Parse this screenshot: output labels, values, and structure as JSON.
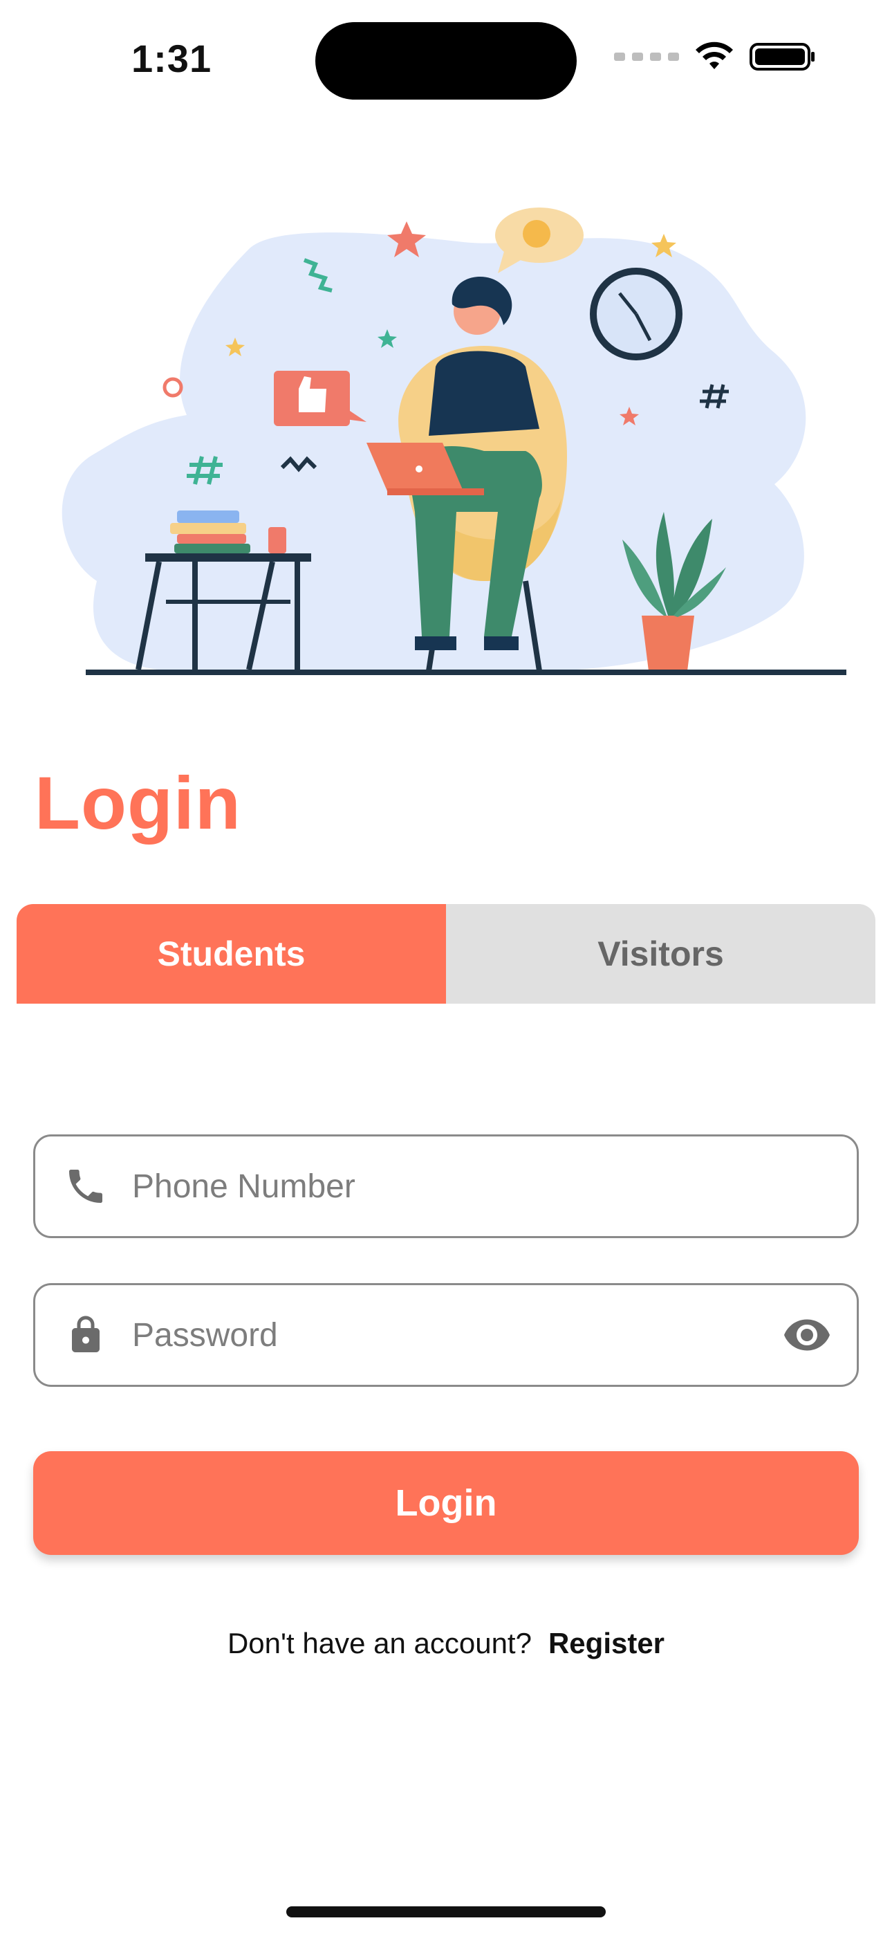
{
  "status_bar": {
    "time": "1:31"
  },
  "page": {
    "title": "Login"
  },
  "tabs": [
    {
      "label": "Students",
      "active": true
    },
    {
      "label": "Visitors",
      "active": false
    }
  ],
  "form": {
    "phone_placeholder": "Phone Number",
    "phone_value": "",
    "password_placeholder": "Password",
    "password_value": ""
  },
  "actions": {
    "login_label": "Login"
  },
  "register": {
    "prompt": "Don't have an account?",
    "link_label": "Register"
  },
  "icons": {
    "phone": "phone-icon",
    "password": "lock-icon",
    "visibility": "eye-icon"
  },
  "colors": {
    "accent": "#FF7358",
    "tab_inactive": "#E0E0E0",
    "text": "#111111"
  }
}
